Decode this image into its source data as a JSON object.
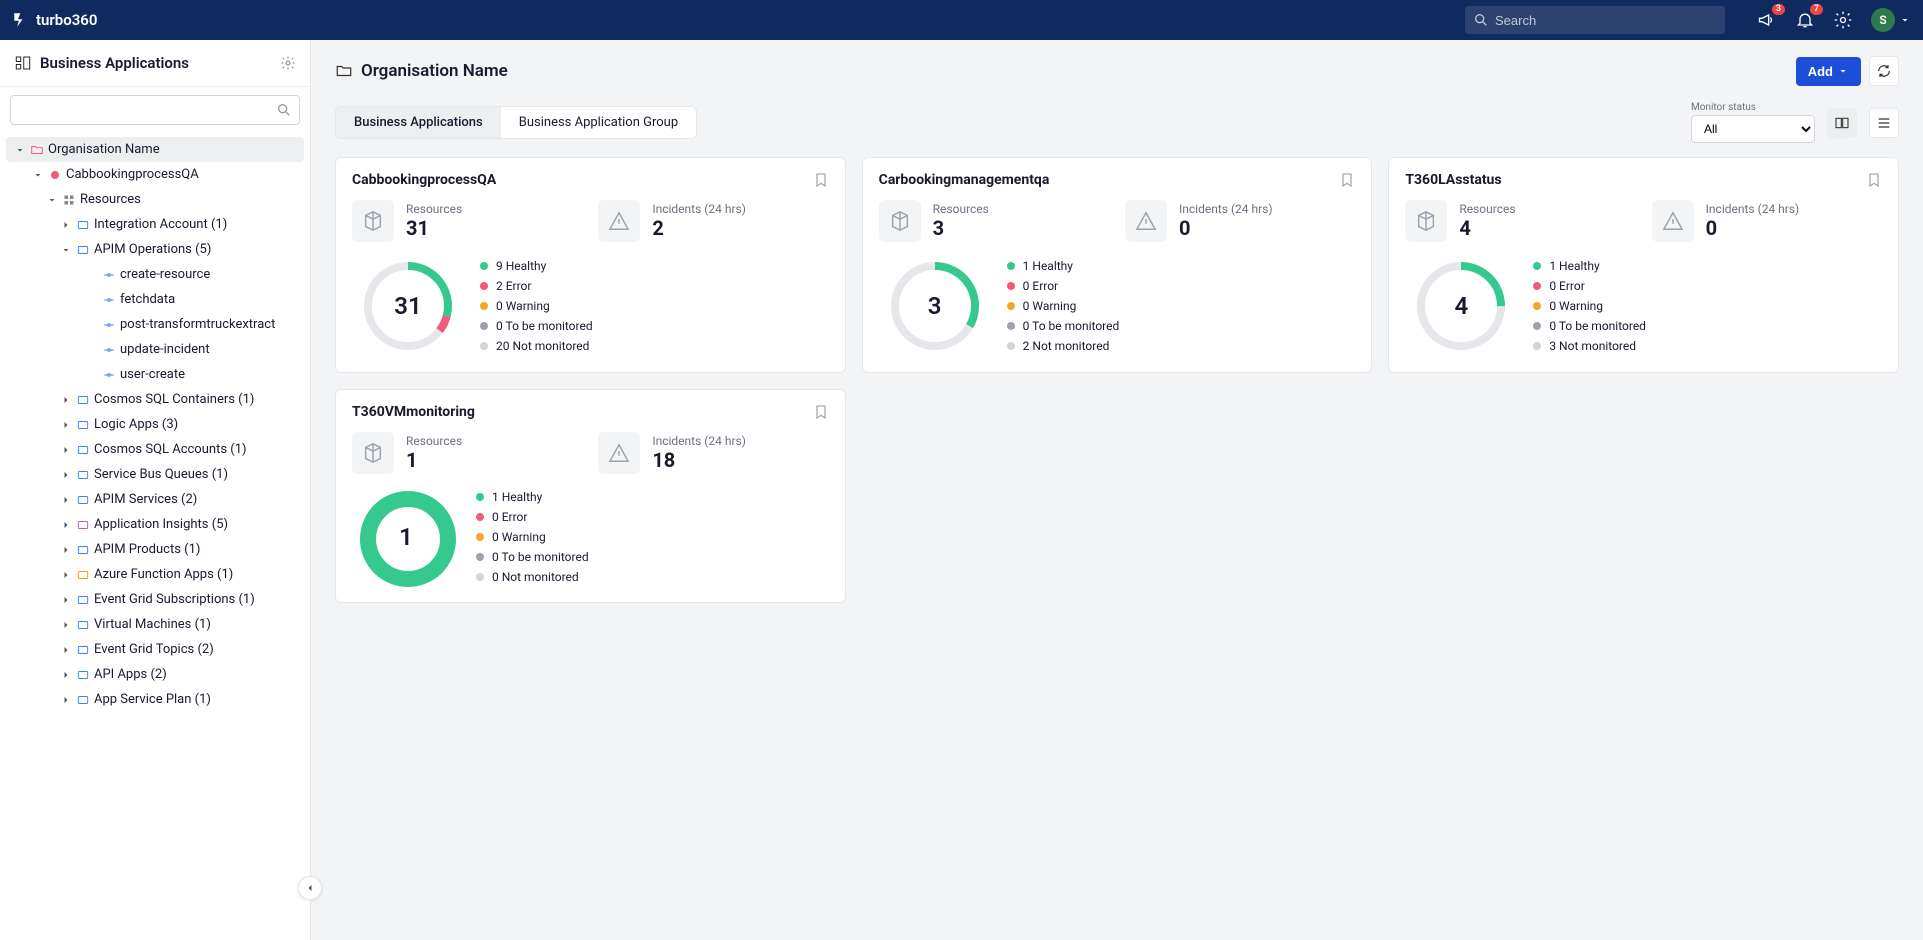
{
  "brand": "turbo360",
  "search_placeholder": "Search",
  "notifications_badge": "3",
  "alerts_badge": "7",
  "avatar_initial": "S",
  "sidebar": {
    "title": "Business Applications",
    "org": "Organisation Name",
    "nodes": {
      "l0": "CabbookingprocessQA",
      "l1": "Resources",
      "integration_account": "Integration Account (1)",
      "apim_ops": "APIM Operations (5)",
      "op1": "create-resource",
      "op2": "fetchdata",
      "op3": "post-transformtruckextract",
      "op4": "update-incident",
      "op5": "user-create",
      "cosmos_sql_containers": "Cosmos SQL Containers (1)",
      "logic_apps": "Logic Apps (3)",
      "cosmos_sql_accounts": "Cosmos SQL Accounts (1)",
      "service_bus_queues": "Service Bus Queues (1)",
      "apim_services": "APIM Services (2)",
      "app_insights": "Application Insights (5)",
      "apim_products": "APIM Products (1)",
      "azure_fn_apps": "Azure Function Apps (1)",
      "event_grid_subs": "Event Grid Subscriptions (1)",
      "virtual_machines": "Virtual Machines (1)",
      "event_grid_topics": "Event Grid Topics (2)",
      "api_apps": "API Apps (2)",
      "app_service_plan": "App Service Plan (1)"
    }
  },
  "page": {
    "title": "Organisation Name",
    "add_label": "Add",
    "tab1": "Business Applications",
    "tab2": "Business Application Group",
    "filter_label": "Monitor status",
    "filter_value": "All"
  },
  "stat_labels": {
    "resources": "Resources",
    "incidents": "Incidents (24 hrs)"
  },
  "legend_labels": {
    "healthy": "Healthy",
    "error": "Error",
    "warning": "Warning",
    "tobe": "To be monitored",
    "notmon": "Not monitored"
  },
  "colors": {
    "healthy": "#36c98e",
    "error": "#ef5b78",
    "warning": "#f5a623",
    "tobe": "#9ca3af",
    "notmon": "#d1d5db",
    "track": "#e5e7eb",
    "accent": "#1d4ed8"
  },
  "cards": [
    {
      "title": "CabbookingprocessQA",
      "resources": "31",
      "incidents": "2",
      "donut_center": "31",
      "segments": [
        {
          "key": "healthy",
          "count": 9
        },
        {
          "key": "error",
          "count": 2
        },
        {
          "key": "warning",
          "count": 0
        },
        {
          "key": "tobe",
          "count": 0
        },
        {
          "key": "notmon",
          "count": 20
        }
      ],
      "style": "thin"
    },
    {
      "title": "Carbookingmanagementqa",
      "resources": "3",
      "incidents": "0",
      "donut_center": "3",
      "segments": [
        {
          "key": "healthy",
          "count": 1
        },
        {
          "key": "error",
          "count": 0
        },
        {
          "key": "warning",
          "count": 0
        },
        {
          "key": "tobe",
          "count": 0
        },
        {
          "key": "notmon",
          "count": 2
        }
      ],
      "style": "thin"
    },
    {
      "title": "T360LAsstatus",
      "resources": "4",
      "incidents": "0",
      "donut_center": "4",
      "segments": [
        {
          "key": "healthy",
          "count": 1
        },
        {
          "key": "error",
          "count": 0
        },
        {
          "key": "warning",
          "count": 0
        },
        {
          "key": "tobe",
          "count": 0
        },
        {
          "key": "notmon",
          "count": 3
        }
      ],
      "style": "thin"
    },
    {
      "title": "T360VMmonitoring",
      "resources": "1",
      "incidents": "18",
      "donut_center": "1",
      "segments": [
        {
          "key": "healthy",
          "count": 1
        },
        {
          "key": "error",
          "count": 0
        },
        {
          "key": "warning",
          "count": 0
        },
        {
          "key": "tobe",
          "count": 0
        },
        {
          "key": "notmon",
          "count": 0
        }
      ],
      "style": "fat"
    }
  ]
}
